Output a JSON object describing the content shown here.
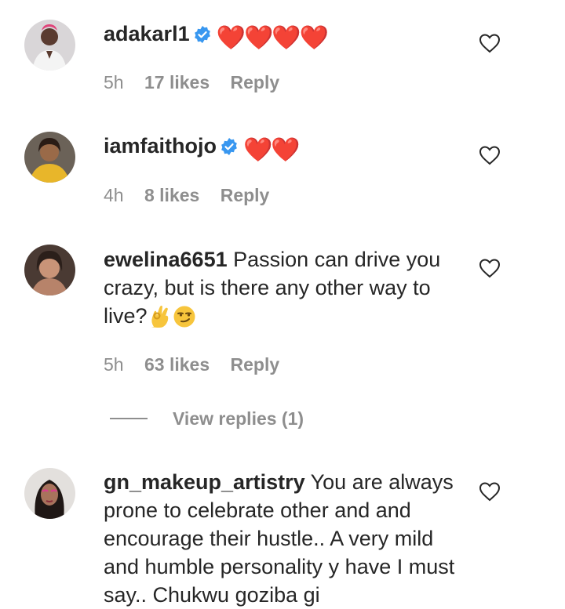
{
  "comments": [
    {
      "username": "adakarl1",
      "verified": true,
      "text": "❤️❤️❤️❤️",
      "time": "5h",
      "likes": "17 likes",
      "reply": "Reply"
    },
    {
      "username": "iamfaithojo",
      "verified": true,
      "text": "❤️❤️",
      "time": "4h",
      "likes": "8 likes",
      "reply": "Reply"
    },
    {
      "username": "ewelina6651",
      "verified": false,
      "text": "Passion can drive you crazy, but is there any other way to live?👌😏",
      "text_main": "Passion can drive you crazy, but is there any other way to live?",
      "time": "5h",
      "likes": "63 likes",
      "reply": "Reply"
    },
    {
      "username": "gn_makeup_artistry",
      "verified": false,
      "text": "You are always prone to celebrate other and and encourage their hustle.. A very mild and humble personality y have I must say.. Chukwu goziba gi",
      "time": "",
      "likes": "",
      "reply": ""
    }
  ],
  "view_replies": "View replies (1)",
  "icons": {
    "like": "heart-outline-icon",
    "verified": "verified-badge-icon"
  },
  "colors": {
    "text": "#262626",
    "secondary": "#8e8e8e",
    "verified": "#3897f0",
    "heart_red": "#e0242f"
  }
}
